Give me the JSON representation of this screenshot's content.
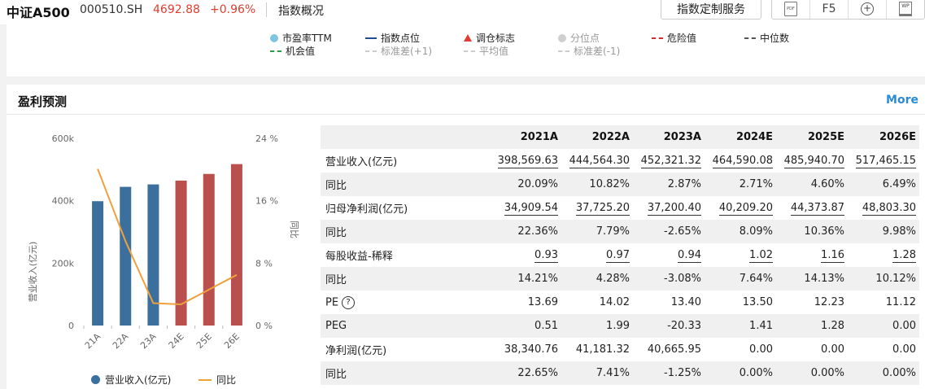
{
  "header": {
    "index_name": "中证A500",
    "code": "000510.SH",
    "price": "4692.88",
    "change": "+0.96%",
    "overview": "指数概况",
    "custom_service": "指数定制服务",
    "pdf_label": "PDF",
    "f5_label": "F5",
    "plus_label": "+",
    "wp_label": "WP"
  },
  "legend": {
    "pe_ttm": "市盈率TTM",
    "index_points": "指数点位",
    "rebalance": "调仓标志",
    "percentile": "分位点",
    "danger": "危险值",
    "median": "中位数",
    "opportunity": "机会值",
    "std_plus": "标准差(+1)",
    "mean": "平均值",
    "std_minus": "标准差(-1)"
  },
  "panel": {
    "title": "盈利预测",
    "more": "More"
  },
  "chart_data": {
    "type": "bar",
    "categories": [
      "21A",
      "22A",
      "23A",
      "24E",
      "25E",
      "26E"
    ],
    "series": [
      {
        "name": "营业收入(亿元)",
        "type": "bar",
        "values": [
          398569.63,
          444564.3,
          452321.32,
          464590.08,
          485940.7,
          517465.15
        ]
      },
      {
        "name": "同比",
        "type": "line",
        "axis": "right",
        "values": [
          20.09,
          10.82,
          2.87,
          2.71,
          4.6,
          6.49
        ]
      }
    ],
    "left_ticks": [
      "600k",
      "400k",
      "200k",
      "0"
    ],
    "right_ticks": [
      "24 %",
      "16 %",
      "8 %",
      "0 %"
    ],
    "ylabel": "营业收入(亿元)",
    "y2label": "同比",
    "ylim": [
      0,
      600000
    ],
    "y2lim": [
      0,
      24
    ],
    "colors": {
      "actual": "#3a6f9e",
      "estimate": "#b9504d",
      "line": "#f0a03c"
    }
  },
  "table": {
    "headers": [
      "",
      "2021A",
      "2022A",
      "2023A",
      "2024E",
      "2025E",
      "2026E"
    ],
    "rows": [
      {
        "label": "营业收入(亿元)",
        "values": [
          "398,569.63",
          "444,564.30",
          "452,321.32",
          "464,590.08",
          "485,940.70",
          "517,465.15"
        ]
      },
      {
        "label": "同比",
        "values": [
          "20.09%",
          "10.82%",
          "2.87%",
          "2.71%",
          "4.60%",
          "6.49%"
        ]
      },
      {
        "label": "归母净利润(亿元)",
        "values": [
          "34,909.54",
          "37,725.20",
          "37,200.40",
          "40,209.20",
          "44,373.87",
          "48,803.30"
        ]
      },
      {
        "label": "同比",
        "values": [
          "22.36%",
          "7.79%",
          "-2.65%",
          "8.09%",
          "10.36%",
          "9.98%"
        ]
      },
      {
        "label": "每股收益-稀释",
        "values": [
          "0.93",
          "0.97",
          "0.94",
          "1.02",
          "1.16",
          "1.28"
        ]
      },
      {
        "label": "同比",
        "values": [
          "14.21%",
          "4.28%",
          "-3.08%",
          "7.64%",
          "14.13%",
          "10.12%"
        ]
      },
      {
        "label": "PE",
        "values": [
          "13.69",
          "14.02",
          "13.40",
          "13.50",
          "12.23",
          "11.12"
        ]
      },
      {
        "label": "PEG",
        "values": [
          "0.51",
          "1.99",
          "-20.33",
          "1.41",
          "1.28",
          "0.00"
        ]
      },
      {
        "label": "净利润(亿元)",
        "values": [
          "38,340.76",
          "41,181.32",
          "40,665.95",
          "0.00",
          "0.00",
          "0.00"
        ]
      },
      {
        "label": "同比",
        "values": [
          "22.65%",
          "7.41%",
          "-1.25%",
          "0.00%",
          "0.00%",
          "0.00%"
        ]
      }
    ],
    "help_icon": "?"
  }
}
